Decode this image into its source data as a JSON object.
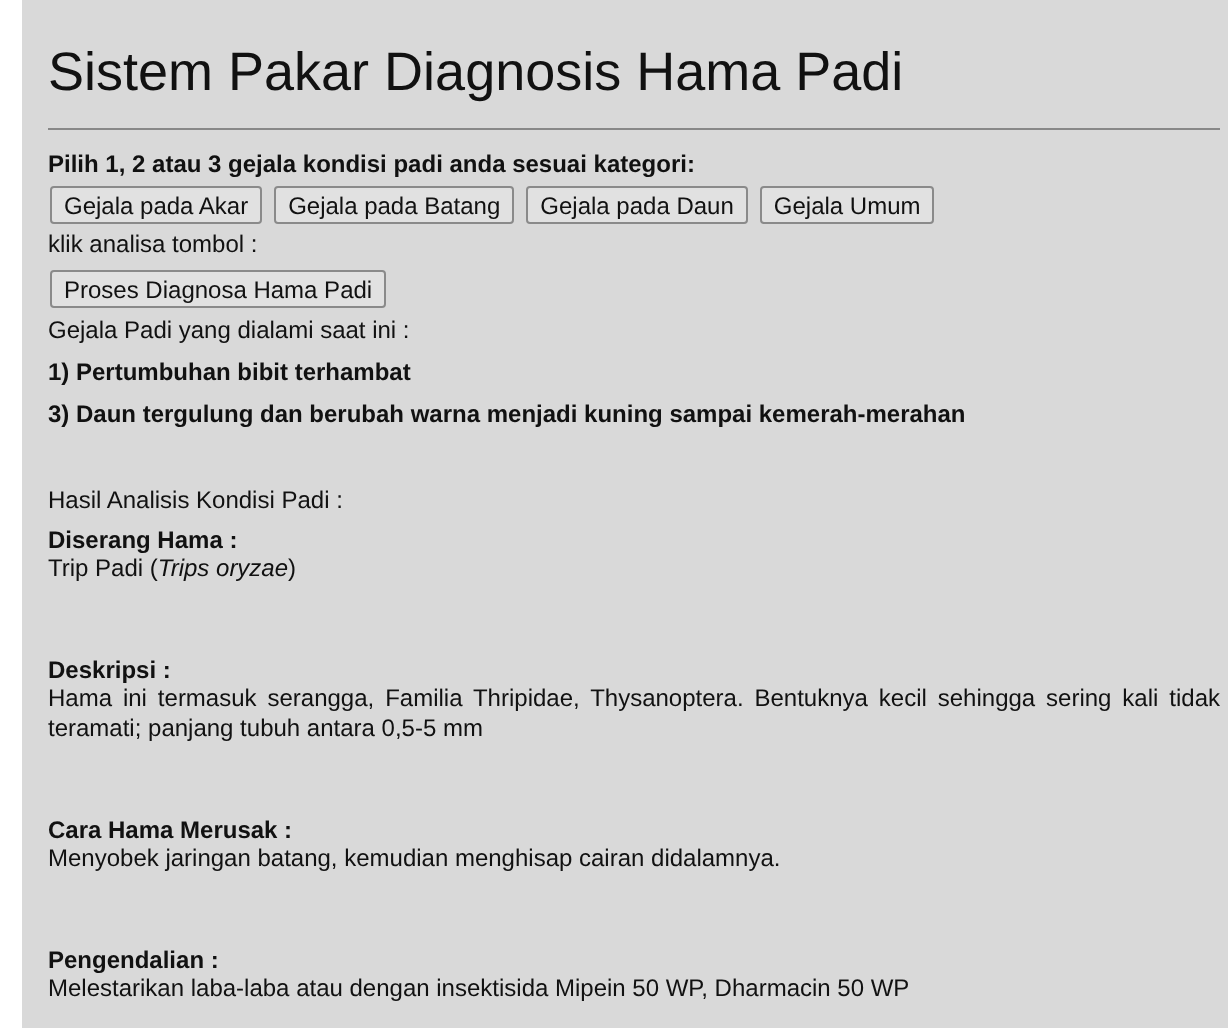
{
  "title": "Sistem Pakar Diagnosis Hama Padi",
  "instruction": "Pilih 1, 2 atau 3 gejala kondisi padi anda sesuai kategori:",
  "category_buttons": [
    "Gejala pada Akar",
    "Gejala pada Batang",
    "Gejala pada Daun",
    "Gejala Umum"
  ],
  "analyze_hint": "klik analisa tombol :",
  "analyze_button": "Proses Diagnosa Hama Padi",
  "symptoms_heading": "Gejala Padi yang dialami saat ini :",
  "symptoms": [
    "1) Pertumbuhan bibit terhambat",
    "3) Daun tergulung dan berubah warna menjadi kuning sampai kemerah-merahan"
  ],
  "result_heading": "Hasil Analisis Kondisi Padi :",
  "results": [
    {
      "label": "Diserang Hama :",
      "text": "Trip Padi (*Trips oryzae*)"
    },
    {
      "label": "Deskripsi :",
      "text": "Hama ini termasuk serangga, Familia Thripidae, Thysanoptera. Bentuknya kecil sehingga sering kali tidak teramati; panjang tubuh antara 0,5-5 mm"
    },
    {
      "label": "Cara Hama Merusak :",
      "text": "Menyobek jaringan batang, kemudian menghisap cairan didalamnya."
    },
    {
      "label": "Pengendalian :",
      "text": "Melestarikan laba-laba atau dengan insektisida Mipein 50 WP, Dharmacin 50 WP"
    }
  ]
}
